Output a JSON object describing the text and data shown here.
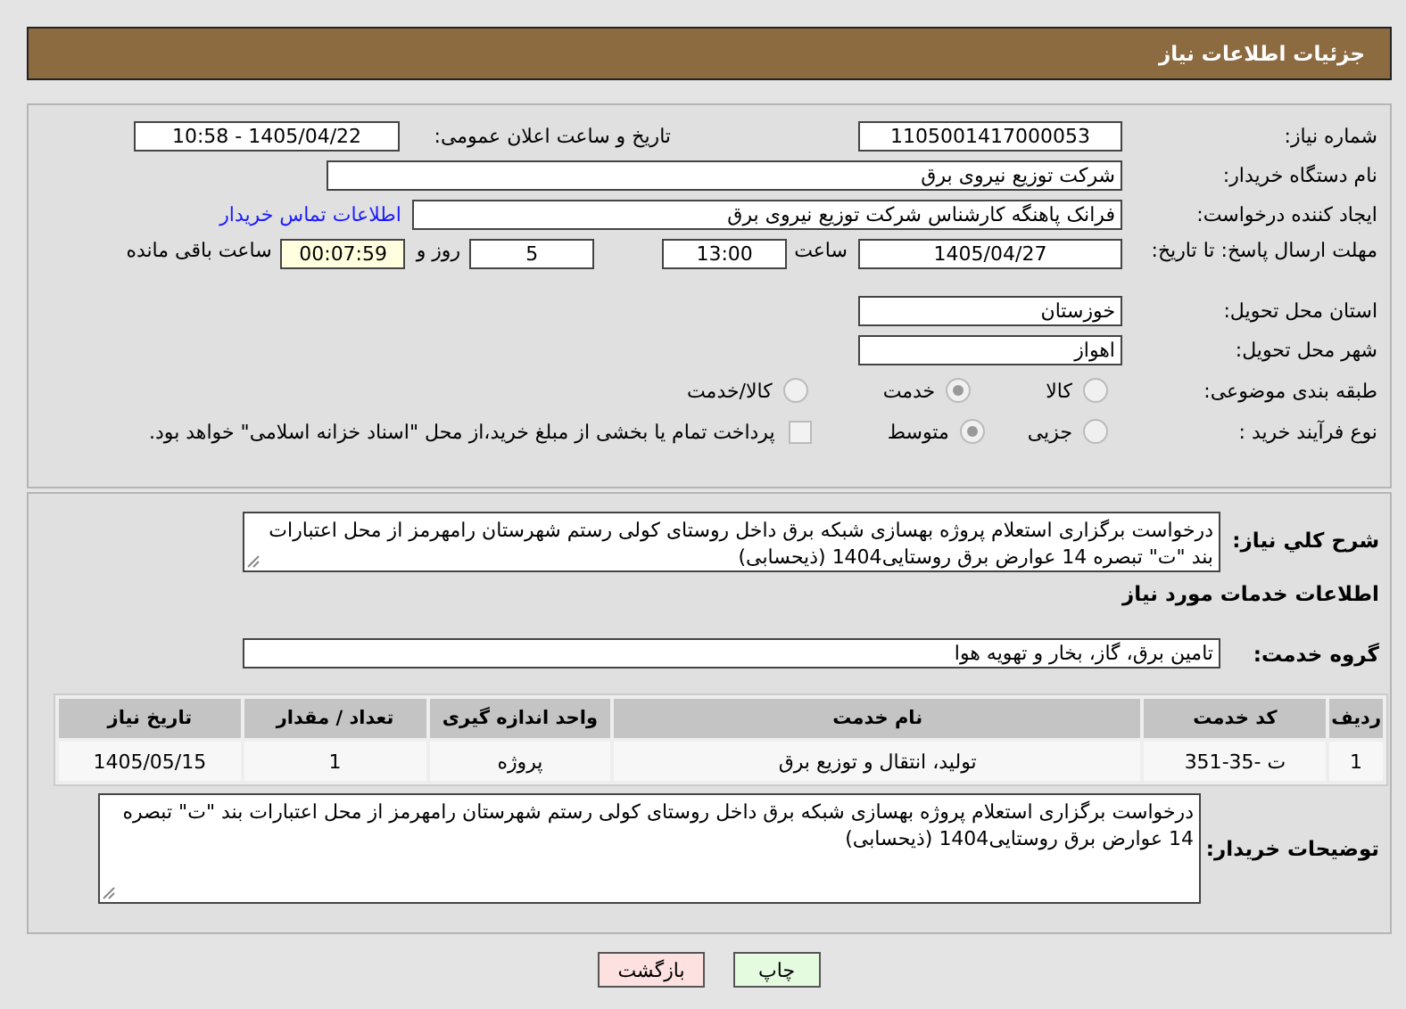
{
  "header": {
    "title": "جزئیات اطلاعات نیاز"
  },
  "need_number": {
    "label": "شماره نیاز:",
    "value": "1105001417000053"
  },
  "announcement": {
    "label": "تاریخ و ساعت اعلان عمومی:",
    "value": "1405/04/22 - 10:58"
  },
  "buyer": {
    "label": "نام دستگاه خریدار:",
    "value": "شرکت توزیع نیروی برق"
  },
  "creator": {
    "label": "ایجاد کننده درخواست:",
    "value": "فرانک  پاهنگه کارشناس  شرکت توزیع نیروی برق",
    "contact_link": "اطلاعات تماس خریدار"
  },
  "deadline": {
    "label": "مهلت ارسال پاسخ: تا تاریخ:",
    "date": "1405/04/27",
    "time_label": "ساعت",
    "time": "13:00",
    "days": "5",
    "days_label": "روز و",
    "remaining": "00:07:59",
    "remaining_label": "ساعت باقی مانده"
  },
  "province": {
    "label": "استان محل تحویل:",
    "value": "خوزستان"
  },
  "city": {
    "label": "شهر محل تحویل:",
    "value": "اهواز"
  },
  "category": {
    "label": "طبقه بندی موضوعی:",
    "options": [
      {
        "label": "کالا",
        "selected": false
      },
      {
        "label": "خدمت",
        "selected": true
      },
      {
        "label": "کالا/خدمت",
        "selected": false
      }
    ]
  },
  "process": {
    "label": "نوع فرآیند خرید :",
    "options": [
      {
        "label": "جزیی",
        "selected": false
      },
      {
        "label": "متوسط",
        "selected": true
      }
    ],
    "payment": {
      "label": "پرداخت تمام یا بخشی از مبلغ خرید،از محل \"اسناد خزانه اسلامی\" خواهد بود.",
      "checked": false
    }
  },
  "description": {
    "label": "شرح کلي نياز:",
    "value": "درخواست برگزاری استعلام پروژه بهسازی شبکه برق داخل روستای کولی رستم شهرستان رامهرمز از محل اعتبارات بند \"ت\" تبصره 14 عوارض برق روستایی1404 (ذیحسابی)"
  },
  "services_title": "اطلاعات خدمات مورد نیاز",
  "service_group": {
    "label": "گروه خدمت:",
    "value": "تامین برق، گاز، بخار و تهویه هوا"
  },
  "table": {
    "columns": [
      "ردیف",
      "کد خدمت",
      "نام خدمت",
      "واحد اندازه گیری",
      "تعداد / مقدار",
      "تاریخ نیاز"
    ],
    "rows": [
      [
        "1",
        "ت -35-351",
        "تولید، انتقال و توزیع برق",
        "پروژه",
        "1",
        "1405/05/15"
      ]
    ]
  },
  "buyer_notes": {
    "label": "توضیحات خریدار:",
    "value": "درخواست برگزاری استعلام پروژه بهسازی شبکه برق داخل روستای کولی رستم شهرستان رامهرمز از محل اعتبارات بند \"ت\" تبصره 14 عوارض برق روستایی1404 (ذیحسابی)"
  },
  "buttons": [
    {
      "label": "چاپ",
      "kind": "print"
    },
    {
      "label": "بازگشت",
      "kind": "back"
    }
  ]
}
